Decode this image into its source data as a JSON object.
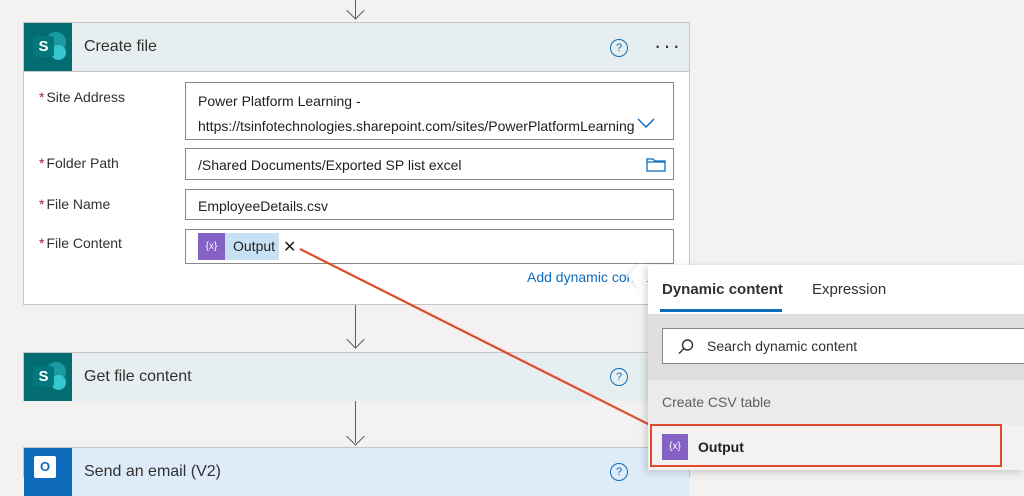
{
  "create_file": {
    "title": "Create file",
    "help_symbol": "?",
    "more_symbol": "···",
    "fields": {
      "site_address": {
        "label": "Site Address",
        "line1": "Power Platform Learning -",
        "line2": "https://tsinfotechnologies.sharepoint.com/sites/PowerPlatformLearning"
      },
      "folder_path": {
        "label": "Folder Path",
        "value": "/Shared Documents/Exported SP list excel"
      },
      "file_name": {
        "label": "File Name",
        "value": "EmployeeDetails.csv"
      },
      "file_content": {
        "label": "File Content",
        "token_label": "Output",
        "token_icon": "{x}"
      }
    },
    "required_mark": "*",
    "add_dynamic_link": "Add dynamic conter"
  },
  "get_file_content": {
    "title": "Get file content",
    "help_symbol": "?"
  },
  "send_email": {
    "title": "Send an email (V2)",
    "help_symbol": "?"
  },
  "dynamic_panel": {
    "tabs": [
      "Dynamic content",
      "Expression"
    ],
    "search_placeholder": "Search dynamic content",
    "section": "Create CSV table",
    "item": {
      "label": "Output",
      "icon": "{x}"
    }
  },
  "colors": {
    "sharepoint": "#036c70",
    "outlook": "#0f6cbd",
    "variable": "#8661c5",
    "highlight": "#e04b2c",
    "accent": "#0f6cbd"
  }
}
